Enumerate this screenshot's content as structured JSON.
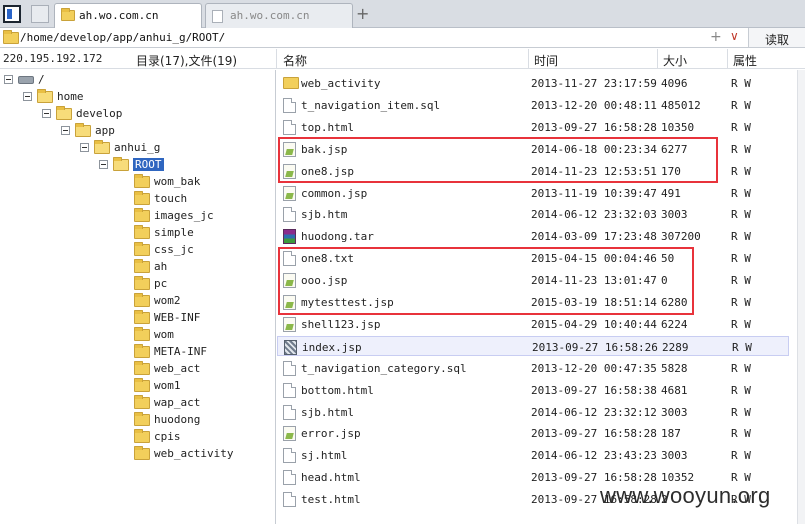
{
  "tabs": [
    {
      "label": "ah.wo.com.cn",
      "active": true
    },
    {
      "label": "ah.wo.com.cn",
      "active": false
    }
  ],
  "address": {
    "path": "/home/develop/app/anhui_g/ROOT/",
    "read_label": "读取"
  },
  "header": {
    "ip": "220.195.192.172",
    "count": "目录(17),文件(19)",
    "col_name": "名称",
    "col_time": "时间",
    "col_size": "大小",
    "col_attr": "属性"
  },
  "tree": [
    {
      "label": "/",
      "kind": "drive"
    },
    {
      "label": "home",
      "kind": "folder"
    },
    {
      "label": "develop",
      "kind": "folder"
    },
    {
      "label": "app",
      "kind": "folder"
    },
    {
      "label": "anhui_g",
      "kind": "folder"
    },
    {
      "label": "ROOT",
      "kind": "folder",
      "selected": true
    },
    {
      "label": "wom_bak"
    },
    {
      "label": "touch"
    },
    {
      "label": "images_jc"
    },
    {
      "label": "simple"
    },
    {
      "label": "css_jc"
    },
    {
      "label": "ah"
    },
    {
      "label": "pc"
    },
    {
      "label": "wom2"
    },
    {
      "label": "WEB-INF"
    },
    {
      "label": "wom"
    },
    {
      "label": "META-INF"
    },
    {
      "label": "web_act"
    },
    {
      "label": "wom1"
    },
    {
      "label": "wap_act"
    },
    {
      "label": "huodong"
    },
    {
      "label": "cpis"
    },
    {
      "label": "web_activity"
    }
  ],
  "files": [
    {
      "name": "web_activity",
      "time": "2013-11-27 23:17:59",
      "size": "4096",
      "attr": "R W",
      "icon": "folder-icon"
    },
    {
      "name": "t_navigation_item.sql",
      "time": "2013-12-20 00:48:11",
      "size": "485012",
      "attr": "R W",
      "icon": "doc-icon"
    },
    {
      "name": "top.html",
      "time": "2013-09-27 16:58:28",
      "size": "10350",
      "attr": "R W",
      "icon": "doc-icon"
    },
    {
      "name": "bak.jsp",
      "time": "2014-06-18 00:23:34",
      "size": "6277",
      "attr": "R W",
      "icon": "jsp-icon"
    },
    {
      "name": "one8.jsp",
      "time": "2014-11-23 12:53:51",
      "size": "170",
      "attr": "R W",
      "icon": "jsp-icon"
    },
    {
      "name": "common.jsp",
      "time": "2013-11-19 10:39:47",
      "size": "491",
      "attr": "R W",
      "icon": "jsp-icon"
    },
    {
      "name": "sjb.htm",
      "time": "2014-06-12 23:32:03",
      "size": "3003",
      "attr": "R W",
      "icon": "doc-icon"
    },
    {
      "name": "huodong.tar",
      "time": "2014-03-09 17:23:48",
      "size": "307200",
      "attr": "R W",
      "icon": "archive-icon"
    },
    {
      "name": "one8.txt",
      "time": "2015-04-15 00:04:46",
      "size": "50",
      "attr": "R W",
      "icon": "doc-icon"
    },
    {
      "name": "ooo.jsp",
      "time": "2014-11-23 13:01:47",
      "size": "0",
      "attr": "R W",
      "icon": "jsp-icon"
    },
    {
      "name": "mytesttest.jsp",
      "time": "2015-03-19 18:51:14",
      "size": "6280",
      "attr": "R W",
      "icon": "jsp-icon"
    },
    {
      "name": "shell123.jsp",
      "time": "2015-04-29 10:40:44",
      "size": "6224",
      "attr": "R W",
      "icon": "jsp-icon"
    },
    {
      "name": "index.jsp",
      "time": "2013-09-27 16:58:26",
      "size": "2289",
      "attr": "R W",
      "icon": "grid-icon",
      "selected": true
    },
    {
      "name": "t_navigation_category.sql",
      "time": "2013-12-20 00:47:35",
      "size": "5828",
      "attr": "R W",
      "icon": "doc-icon"
    },
    {
      "name": "bottom.html",
      "time": "2013-09-27 16:58:38",
      "size": "4681",
      "attr": "R W",
      "icon": "doc-icon"
    },
    {
      "name": "sjb.html",
      "time": "2014-06-12 23:32:12",
      "size": "3003",
      "attr": "R W",
      "icon": "doc-icon"
    },
    {
      "name": "error.jsp",
      "time": "2013-09-27 16:58:28",
      "size": "187",
      "attr": "R W",
      "icon": "jsp-icon"
    },
    {
      "name": "sj.html",
      "time": "2014-06-12 23:43:23",
      "size": "3003",
      "attr": "R W",
      "icon": "doc-icon"
    },
    {
      "name": "head.html",
      "time": "2013-09-27 16:58:28",
      "size": "10352",
      "attr": "R W",
      "icon": "doc-icon"
    },
    {
      "name": "test.html",
      "time": "2013-09-27 16:58:28",
      "size": "2",
      "attr": "R W",
      "icon": "doc-icon"
    }
  ],
  "watermark": "www.wooyun.org",
  "colors": {
    "selection": "#2f66c0",
    "highlight_box": "#e8333b"
  }
}
